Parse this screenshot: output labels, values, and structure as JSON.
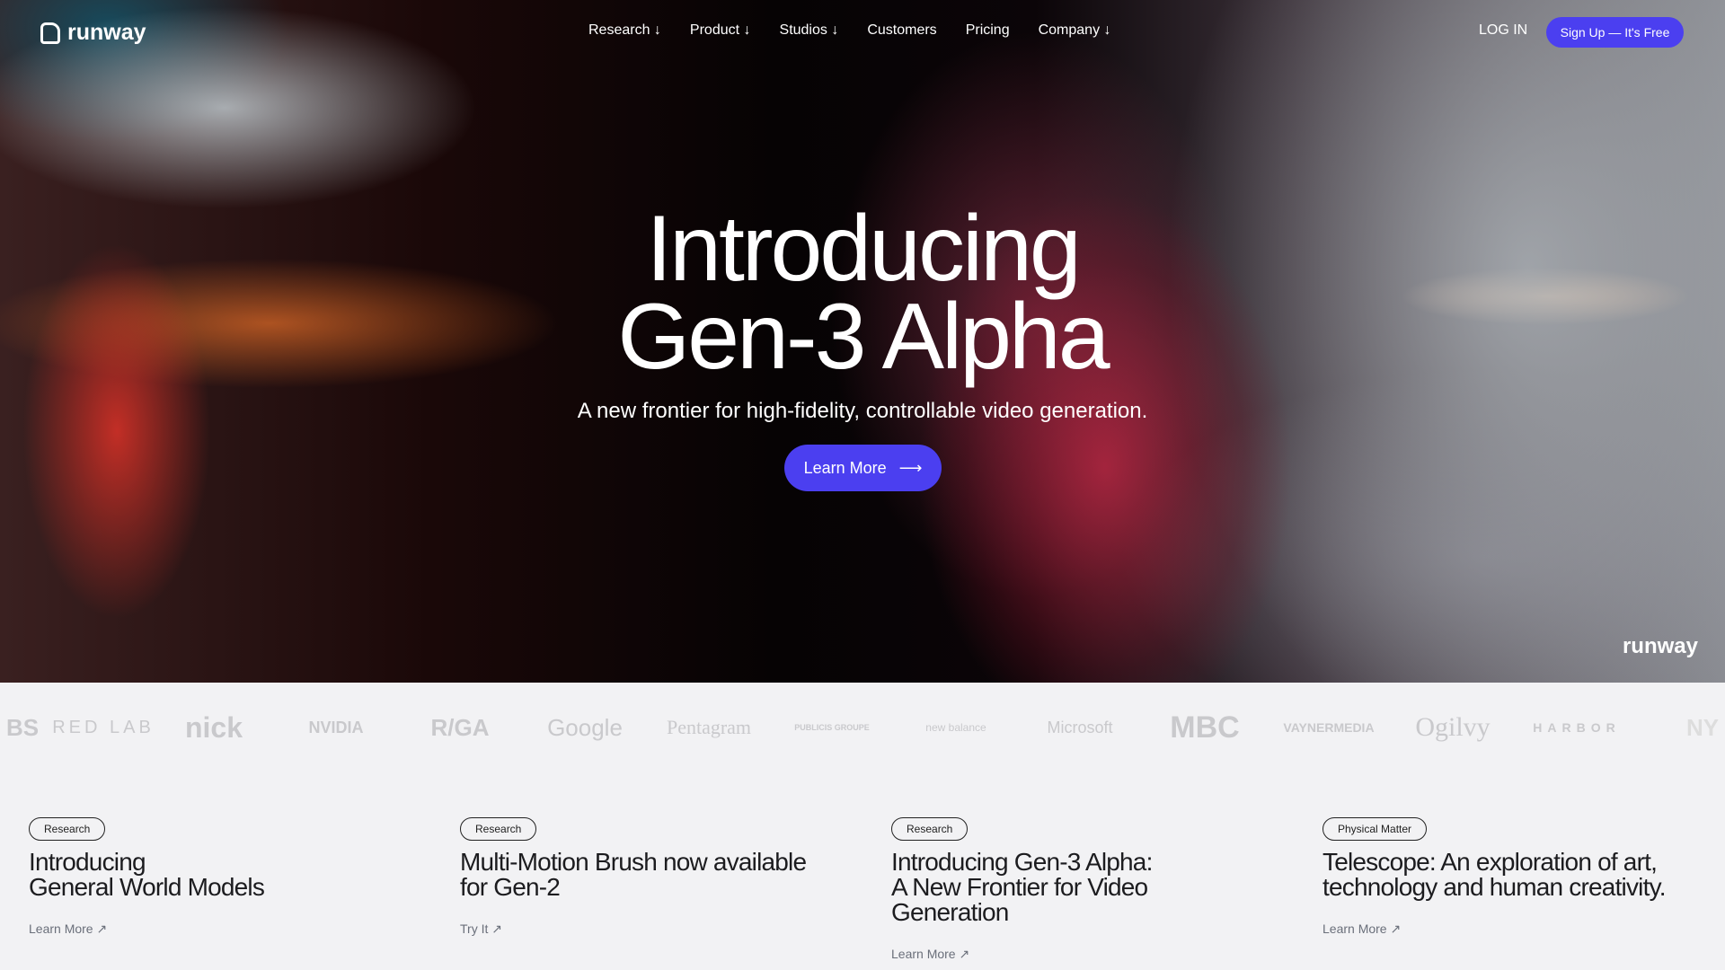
{
  "nav": {
    "brand": "runway",
    "items": [
      "Research ↓",
      "Product ↓",
      "Studios ↓",
      "Customers",
      "Pricing",
      "Company ↓"
    ],
    "login": "LOG IN",
    "signup": "Sign Up — It's Free"
  },
  "hero": {
    "title_line1": "Introducing",
    "title_line2": "Gen-3 Alpha",
    "subtitle": "A new frontier for high-fidelity, controllable video generation.",
    "cta": "Learn More",
    "cta_icon": "arrow-right-icon",
    "watermark": "runway"
  },
  "logos": [
    "BS",
    "RED LAB",
    "nick",
    "NVIDIA",
    "R/GA",
    "Google",
    "Pentagram",
    "PUBLICIS GROUPE",
    "new balance",
    "Microsoft",
    "MBC",
    "VAYNERMEDIA",
    "Ogilvy",
    "HARBOR",
    "NY"
  ],
  "cards": [
    {
      "tag": "Research",
      "title": "Introducing\nGeneral World Models",
      "link": "Learn More ↗"
    },
    {
      "tag": "Research",
      "title": "Multi-Motion Brush now available\nfor Gen-2",
      "link": "Try It ↗"
    },
    {
      "tag": "Research",
      "title": "Introducing Gen-3 Alpha:\nA New Frontier for Video\nGeneration",
      "link": "Learn More ↗"
    },
    {
      "tag": "Physical Matter",
      "title": "Telescope: An exploration of art,\ntechnology and human creativity.",
      "link": "Learn More ↗"
    }
  ],
  "colors": {
    "accent": "#4b3ff0",
    "background": "#f2f2f4"
  }
}
